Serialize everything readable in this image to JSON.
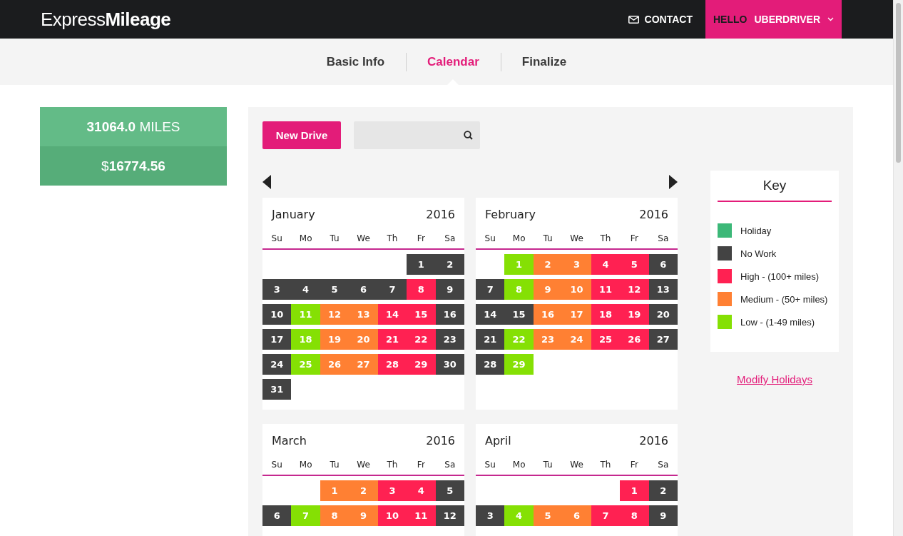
{
  "header": {
    "logo_light": "Express",
    "logo_bold": "Mileage",
    "contact": "CONTACT",
    "greeting": "HELLO",
    "user": "UBERDRIVER"
  },
  "steps": [
    {
      "label": "Basic Info",
      "selected": false
    },
    {
      "label": "Calendar",
      "selected": true
    },
    {
      "label": "Finalize",
      "selected": false
    }
  ],
  "totals": {
    "miles_value": "31064.0",
    "miles_unit": "MILES",
    "amount_symbol": "$",
    "amount_value": "16774.56"
  },
  "toolbar": {
    "new_drive": "New Drive"
  },
  "key": {
    "title": "Key",
    "items": [
      {
        "kind": "holiday",
        "label": "Holiday",
        "color": "#3cb878"
      },
      {
        "kind": "nowork",
        "label": "No Work",
        "color": "#434343"
      },
      {
        "kind": "high",
        "label": "High - (100+ miles)",
        "color": "#ff2152"
      },
      {
        "kind": "medium",
        "label": "Medium - (50+ miles)",
        "color": "#ff8033"
      },
      {
        "kind": "low",
        "label": "Low - (1-49 miles)",
        "color": "#85e004"
      }
    ],
    "link": "Modify Holidays"
  },
  "months": [
    {
      "name": "January",
      "year": "2016",
      "weekdays": [
        "Su",
        "Mo",
        "Tu",
        "We",
        "Th",
        "Fr",
        "Sa"
      ],
      "weeks": [
        [
          {
            "kind": "empty"
          },
          {
            "kind": "empty"
          },
          {
            "kind": "empty"
          },
          {
            "kind": "empty"
          },
          {
            "kind": "empty"
          },
          {
            "day": "1",
            "kind": "nowork"
          },
          {
            "day": "2",
            "kind": "nowork"
          }
        ],
        [
          {
            "day": "3",
            "kind": "nowork"
          },
          {
            "day": "4",
            "kind": "nowork"
          },
          {
            "day": "5",
            "kind": "nowork"
          },
          {
            "day": "6",
            "kind": "nowork"
          },
          {
            "day": "7",
            "kind": "nowork"
          },
          {
            "day": "8",
            "kind": "high"
          },
          {
            "day": "9",
            "kind": "nowork"
          }
        ],
        [
          {
            "day": "10",
            "kind": "nowork"
          },
          {
            "day": "11",
            "kind": "low"
          },
          {
            "day": "12",
            "kind": "medium"
          },
          {
            "day": "13",
            "kind": "medium"
          },
          {
            "day": "14",
            "kind": "high"
          },
          {
            "day": "15",
            "kind": "high"
          },
          {
            "day": "16",
            "kind": "nowork"
          }
        ],
        [
          {
            "day": "17",
            "kind": "nowork"
          },
          {
            "day": "18",
            "kind": "low"
          },
          {
            "day": "19",
            "kind": "medium"
          },
          {
            "day": "20",
            "kind": "medium"
          },
          {
            "day": "21",
            "kind": "high"
          },
          {
            "day": "22",
            "kind": "high"
          },
          {
            "day": "23",
            "kind": "nowork"
          }
        ],
        [
          {
            "day": "24",
            "kind": "nowork"
          },
          {
            "day": "25",
            "kind": "low"
          },
          {
            "day": "26",
            "kind": "medium"
          },
          {
            "day": "27",
            "kind": "medium"
          },
          {
            "day": "28",
            "kind": "high"
          },
          {
            "day": "29",
            "kind": "high"
          },
          {
            "day": "30",
            "kind": "nowork"
          }
        ],
        [
          {
            "day": "31",
            "kind": "nowork"
          }
        ]
      ]
    },
    {
      "name": "February",
      "year": "2016",
      "weekdays": [
        "Su",
        "Mo",
        "Tu",
        "We",
        "Th",
        "Fr",
        "Sa"
      ],
      "weeks": [
        [
          {
            "kind": "empty"
          },
          {
            "day": "1",
            "kind": "low"
          },
          {
            "day": "2",
            "kind": "medium"
          },
          {
            "day": "3",
            "kind": "medium"
          },
          {
            "day": "4",
            "kind": "high"
          },
          {
            "day": "5",
            "kind": "high"
          },
          {
            "day": "6",
            "kind": "nowork"
          }
        ],
        [
          {
            "day": "7",
            "kind": "nowork"
          },
          {
            "day": "8",
            "kind": "low"
          },
          {
            "day": "9",
            "kind": "medium"
          },
          {
            "day": "10",
            "kind": "medium"
          },
          {
            "day": "11",
            "kind": "high"
          },
          {
            "day": "12",
            "kind": "high"
          },
          {
            "day": "13",
            "kind": "nowork"
          }
        ],
        [
          {
            "day": "14",
            "kind": "nowork"
          },
          {
            "day": "15",
            "kind": "nowork"
          },
          {
            "day": "16",
            "kind": "medium"
          },
          {
            "day": "17",
            "kind": "medium"
          },
          {
            "day": "18",
            "kind": "high"
          },
          {
            "day": "19",
            "kind": "high"
          },
          {
            "day": "20",
            "kind": "nowork"
          }
        ],
        [
          {
            "day": "21",
            "kind": "nowork"
          },
          {
            "day": "22",
            "kind": "low"
          },
          {
            "day": "23",
            "kind": "medium"
          },
          {
            "day": "24",
            "kind": "medium"
          },
          {
            "day": "25",
            "kind": "high"
          },
          {
            "day": "26",
            "kind": "high"
          },
          {
            "day": "27",
            "kind": "nowork"
          }
        ],
        [
          {
            "day": "28",
            "kind": "nowork"
          },
          {
            "day": "29",
            "kind": "low"
          }
        ]
      ]
    },
    {
      "name": "March",
      "year": "2016",
      "weekdays": [
        "Su",
        "Mo",
        "Tu",
        "We",
        "Th",
        "Fr",
        "Sa"
      ],
      "weeks": [
        [
          {
            "kind": "empty"
          },
          {
            "kind": "empty"
          },
          {
            "day": "1",
            "kind": "medium"
          },
          {
            "day": "2",
            "kind": "medium"
          },
          {
            "day": "3",
            "kind": "high"
          },
          {
            "day": "4",
            "kind": "high"
          },
          {
            "day": "5",
            "kind": "nowork"
          }
        ],
        [
          {
            "day": "6",
            "kind": "nowork"
          },
          {
            "day": "7",
            "kind": "low"
          },
          {
            "day": "8",
            "kind": "medium"
          },
          {
            "day": "9",
            "kind": "medium"
          },
          {
            "day": "10",
            "kind": "high"
          },
          {
            "day": "11",
            "kind": "high"
          },
          {
            "day": "12",
            "kind": "nowork"
          }
        ]
      ]
    },
    {
      "name": "April",
      "year": "2016",
      "weekdays": [
        "Su",
        "Mo",
        "Tu",
        "We",
        "Th",
        "Fr",
        "Sa"
      ],
      "weeks": [
        [
          {
            "kind": "empty"
          },
          {
            "kind": "empty"
          },
          {
            "kind": "empty"
          },
          {
            "kind": "empty"
          },
          {
            "kind": "empty"
          },
          {
            "day": "1",
            "kind": "high"
          },
          {
            "day": "2",
            "kind": "nowork"
          }
        ],
        [
          {
            "day": "3",
            "kind": "nowork"
          },
          {
            "day": "4",
            "kind": "low"
          },
          {
            "day": "5",
            "kind": "medium"
          },
          {
            "day": "6",
            "kind": "medium"
          },
          {
            "day": "7",
            "kind": "high"
          },
          {
            "day": "8",
            "kind": "high"
          },
          {
            "day": "9",
            "kind": "nowork"
          }
        ]
      ]
    }
  ]
}
